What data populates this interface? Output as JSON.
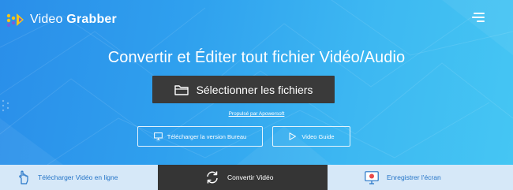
{
  "header": {
    "logo_text_light": "Video",
    "logo_text_bold": "Grabber",
    "menu_icon": "hamburger-menu-icon"
  },
  "hero": {
    "headline": "Convertir et Éditer tout fichier Vidéo/Audio",
    "select_button_label": "Sélectionner les fichiers",
    "select_button_icon": "folder-icon",
    "powered_by": "Propulsé par Apowersoft",
    "desktop_button_label": "Télécharger la version Bureau",
    "desktop_button_icon": "monitor-icon",
    "guide_button_label": "Video Guide",
    "guide_button_icon": "play-icon"
  },
  "tabs": [
    {
      "label": "Télécharger Vidéo en ligne",
      "icon": "hand-pointer-icon",
      "active": false
    },
    {
      "label": "Convertir Vidéo",
      "icon": "convert-arrows-icon",
      "active": true
    },
    {
      "label": "Enregistrer l'écran",
      "icon": "screen-record-icon",
      "active": false
    }
  ],
  "colors": {
    "hero_gradient_start": "#2a8ee9",
    "hero_gradient_end": "#45c6f3",
    "dark_button": "#3a3a3a",
    "active_tab": "#353535",
    "inactive_tab": "#d6e8f8",
    "tab_text": "#2474c7",
    "logo_yellow": "#f5c518",
    "logo_purple": "#7b5cd6",
    "record_red": "#e84a4a"
  }
}
